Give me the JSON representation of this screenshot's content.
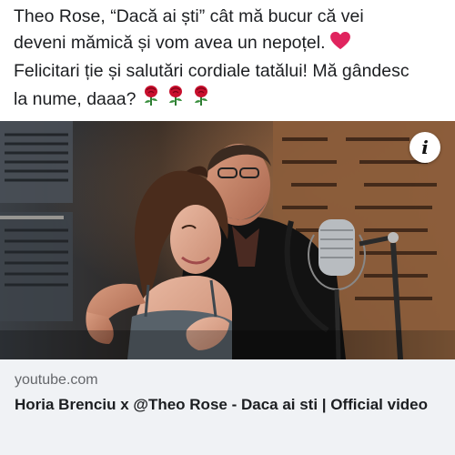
{
  "post": {
    "lines": [
      "Theo Rose, “Dacă ai ști” cât mă bucur că vei",
      "deveni mămică și vom avea un nepoțel.",
      "Felicitari ție și salutări cordiale tatălui! Mă gândesc",
      "la nume, daaa?"
    ],
    "heart_emoji": "❤️",
    "rose_emojis": [
      "🌹",
      "🌹",
      "🌹"
    ]
  },
  "media": {
    "info_label": "i",
    "icon": "info-icon"
  },
  "link_card": {
    "domain": "youtube.com",
    "title": "Horia Brenciu x @Theo Rose - Daca ai sti | Official video"
  },
  "colors": {
    "text": "#1c1e21",
    "secondary_text": "#65676b",
    "card_background": "#f0f2f5",
    "heart": "#e0245e",
    "rose": "#c8102e"
  }
}
